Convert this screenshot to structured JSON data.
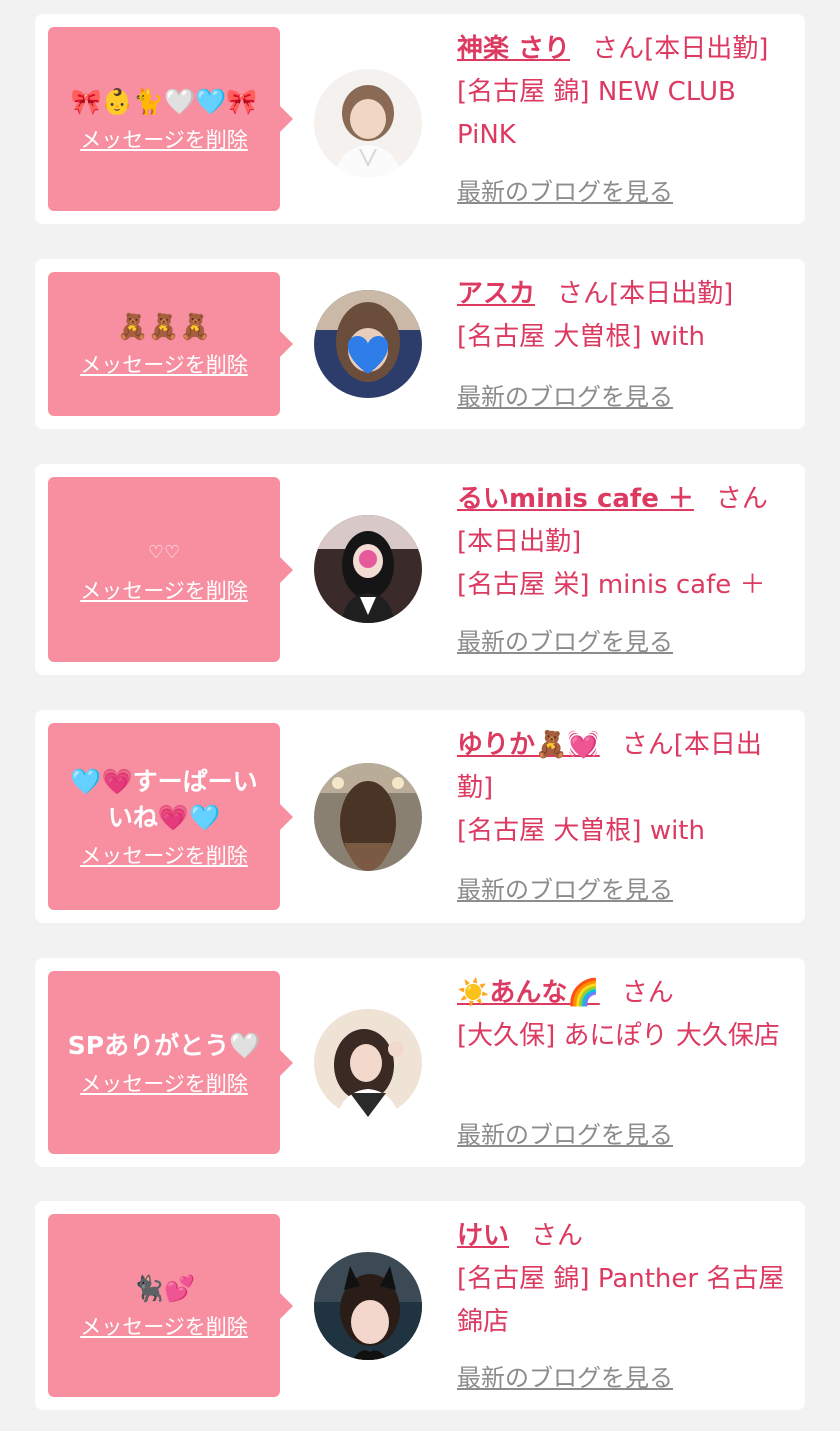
{
  "delete_label": "メッセージを削除",
  "blog_label": "最新のブログを見る",
  "colors": {
    "background": "#f2f2f2",
    "card": "#ffffff",
    "bubble": "#f78fa1",
    "accent_text": "#dc3a61",
    "muted_link": "#8c8c8c"
  },
  "entries": [
    {
      "message": "🎀👶🐈🤍🩵🎀",
      "name": "神楽 さり",
      "suffix": "さん",
      "status": "[本日出勤]",
      "shop": "[名古屋 錦] NEW CLUB PiNK",
      "avatar_icon": "avatar-photo"
    },
    {
      "message": "🧸🧸🧸",
      "name": "アスカ",
      "suffix": "さん",
      "status": "[本日出勤]",
      "shop": "[名古屋 大曽根] with",
      "avatar_icon": "avatar-photo"
    },
    {
      "message": "♡♡",
      "name": "るいminis cafe ＋",
      "suffix": "さん",
      "status": "[本日出勤]",
      "shop": "[名古屋 栄] minis cafe ＋",
      "avatar_icon": "avatar-photo"
    },
    {
      "message": "🩵💗すーぱーいいね💗🩵",
      "name": "ゆりか🧸💓",
      "suffix": "さん",
      "status": "[本日出勤]",
      "shop": "[名古屋 大曽根] with",
      "avatar_icon": "avatar-photo"
    },
    {
      "message": "SPありがとう🤍",
      "name": "☀️あんな🌈",
      "suffix": "さん",
      "status": "",
      "shop": "[大久保] あにぽり 大久保店",
      "avatar_icon": "avatar-photo"
    },
    {
      "message": "🐈‍⬛💕",
      "name": "けい",
      "suffix": "さん",
      "status": "",
      "shop": "[名古屋 錦] Panther 名古屋錦店",
      "avatar_icon": "avatar-photo"
    }
  ]
}
